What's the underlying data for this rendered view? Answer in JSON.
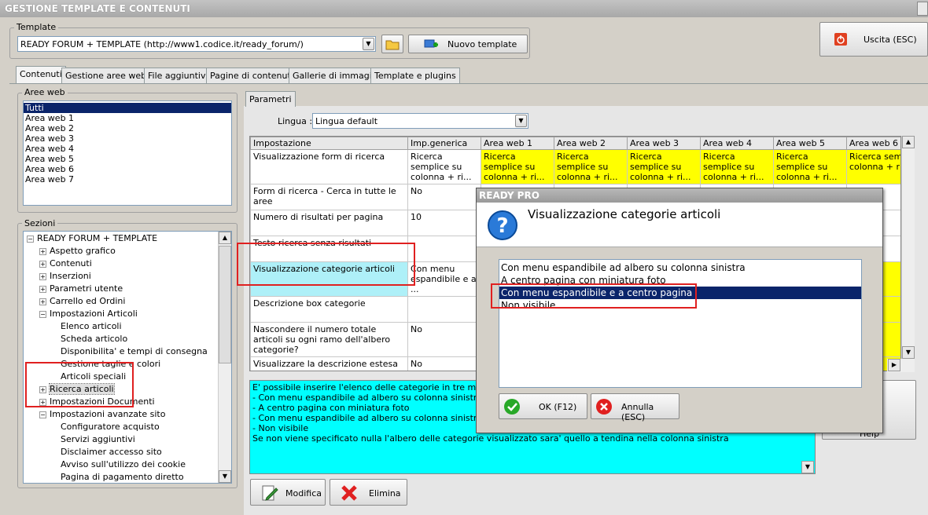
{
  "window": {
    "title": "GESTIONE TEMPLATE E CONTENUTI"
  },
  "template": {
    "group_label": "Template",
    "selected": "READY FORUM + TEMPLATE (http://www1.codice.it/ready_forum/)",
    "new_button": "Nuovo template"
  },
  "exit_button": "Uscita (ESC)",
  "tabs": [
    "Contenuti",
    "Gestione aree web",
    "File aggiuntivi",
    "Pagine di contenuti",
    "Gallerie di immagini",
    "Template e plugins"
  ],
  "aree_web": {
    "label": "Aree web",
    "items": [
      "Tutti",
      "Area web 1",
      "Area web 2",
      "Area web 3",
      "Area web 4",
      "Area web 5",
      "Area web 6",
      "Area web 7"
    ]
  },
  "sezioni": {
    "label": "Sezioni",
    "root": "READY FORUM + TEMPLATE",
    "items": [
      {
        "label": "Aspetto grafico",
        "level": 1,
        "expander": "+"
      },
      {
        "label": "Contenuti",
        "level": 1,
        "expander": "+"
      },
      {
        "label": "Inserzioni",
        "level": 1,
        "expander": "+"
      },
      {
        "label": "Parametri utente",
        "level": 1,
        "expander": "+"
      },
      {
        "label": "Carrello ed Ordini",
        "level": 1,
        "expander": "+"
      },
      {
        "label": "Impostazioni Articoli",
        "level": 1,
        "expander": "-"
      },
      {
        "label": "Elenco articoli",
        "level": 2,
        "expander": ""
      },
      {
        "label": "Scheda articolo",
        "level": 2,
        "expander": ""
      },
      {
        "label": "Disponibilita' e tempi di consegna",
        "level": 2,
        "expander": ""
      },
      {
        "label": "Gestione taglie e colori",
        "level": 2,
        "expander": ""
      },
      {
        "label": "Articoli speciali",
        "level": 2,
        "expander": ""
      },
      {
        "label": "Ricerca articoli",
        "level": 1,
        "expander": "+",
        "selected": true
      },
      {
        "label": "Impostazioni Documenti",
        "level": 1,
        "expander": "+"
      },
      {
        "label": "Impostazioni avanzate sito",
        "level": 1,
        "expander": "-"
      },
      {
        "label": "Configuratore acquisto",
        "level": 2,
        "expander": ""
      },
      {
        "label": "Servizi aggiuntivi",
        "level": 2,
        "expander": ""
      },
      {
        "label": "Disclaimer accesso sito",
        "level": 2,
        "expander": ""
      },
      {
        "label": "Avviso sull'utilizzo dei cookie",
        "level": 2,
        "expander": ""
      },
      {
        "label": "Pagina di pagamento diretto",
        "level": 2,
        "expander": ""
      }
    ]
  },
  "parametri": {
    "tab": "Parametri",
    "lingua_label": "Lingua :",
    "lingua_value": "Lingua default"
  },
  "grid": {
    "columns": [
      "Impostazione",
      "Imp.generica",
      "Area web 1",
      "Area web 2",
      "Area web 3",
      "Area web 4",
      "Area web 5",
      "Area web 6"
    ],
    "rows": [
      {
        "label": "Visualizzazione form di ricerca",
        "cells": [
          "Ricerca semplice su colonna + ri...",
          "Ricerca semplice su colonna + ri...",
          "Ricerca semplice su colonna + ri...",
          "Ricerca semplice su colonna + ri...",
          "Ricerca semplice su colonna + ri...",
          "Ricerca semplice su colonna + ri...",
          "Ricerca sempl su colonna + ri"
        ]
      },
      {
        "label": "Form di ricerca - Cerca in tutte le aree",
        "cells": [
          "No",
          "",
          "",
          "",
          "",
          "",
          ""
        ]
      },
      {
        "label": "Numero di risultati per pagina",
        "cells": [
          "10",
          "",
          "",
          "",
          "",
          "",
          ""
        ]
      },
      {
        "label": "Testo ricerca senza risultati",
        "cells": [
          "",
          "",
          "",
          "",
          "",
          "",
          ""
        ]
      },
      {
        "label": "Visualizzazione categorie articoli",
        "cells": [
          "Con menu espandibile e a ...",
          "",
          "",
          "",
          "",
          "",
          "u e a"
        ]
      },
      {
        "label": "Descrizione box categorie",
        "cells": [
          "",
          "",
          "",
          "",
          "",
          "",
          ""
        ]
      },
      {
        "label": "Nascondere il numero totale articoli su ogni ramo dell'albero categorie?",
        "cells": [
          "No",
          "",
          "",
          "",
          "",
          "",
          ""
        ]
      },
      {
        "label": "Visualizzare la descrizione estesa in ogni box categoria?",
        "cells": [
          "No",
          "",
          "",
          "",
          "",
          "",
          ""
        ]
      }
    ]
  },
  "description": [
    "E' possibile inserire l'elenco delle categorie in tre modalita':",
    "- Con menu espandibile ad albero su colonna sinistra",
    "- A centro pagina con miniatura foto",
    "- Con menu espandibile ad albero su colonna sinistra e a ce",
    "- Non visibile",
    "Se non viene specificato nulla l'albero delle categorie visualizzato sara' quello a tendina nella colonna sinistra"
  ],
  "bottom_buttons": {
    "modifica": "Modifica",
    "elimina": "Elimina",
    "help": "Help"
  },
  "dialog": {
    "app_title": "READY PRO",
    "heading": "Visualizzazione categorie articoli",
    "options": [
      "Con menu espandibile ad albero su colonna sinistra",
      "A centro pagina con miniatura foto",
      "Con menu espandibile e a centro pagina",
      "Non visibile"
    ],
    "selected_index": 2,
    "ok": "OK (F12)",
    "cancel": "Annulla (ESC)"
  },
  "colors": {
    "yellow": "#ffff00",
    "cyan": "#00ffff",
    "selection": "#0a246a",
    "highlight": "#e02020"
  }
}
